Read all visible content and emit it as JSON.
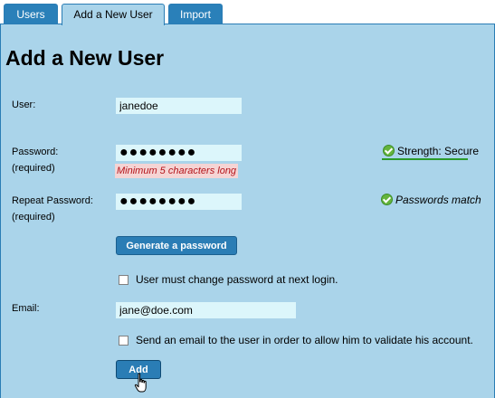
{
  "tabs": [
    {
      "label": "Users"
    },
    {
      "label": "Add a New User"
    },
    {
      "label": "Import"
    }
  ],
  "page_title": "Add a New User",
  "form": {
    "user": {
      "label": "User:",
      "value": "janedoe"
    },
    "password": {
      "label": "Password:",
      "required": "(required)",
      "value": "●●●●●●●●",
      "hint": "Minimum 5 characters long",
      "strength": "Strength: Secure"
    },
    "repeat_password": {
      "label": "Repeat Password:",
      "required": "(required)",
      "value": "●●●●●●●●",
      "match": "Passwords match"
    },
    "generate_label": "Generate a password",
    "must_change_label": "User must change password at next login.",
    "email": {
      "label": "Email:",
      "value": "jane@doe.com"
    },
    "send_email_label": "Send an email to the user in order to allow him to validate his account.",
    "add_label": "Add"
  },
  "colors": {
    "accent": "#2a7db5",
    "panel": "#aad4ea",
    "input": "#dcf6fb",
    "error_bg": "#f5d4d4",
    "error_text": "#b4141a",
    "success": "#64b43c"
  },
  "icons": [
    "check-icon",
    "hand-cursor-icon"
  ]
}
